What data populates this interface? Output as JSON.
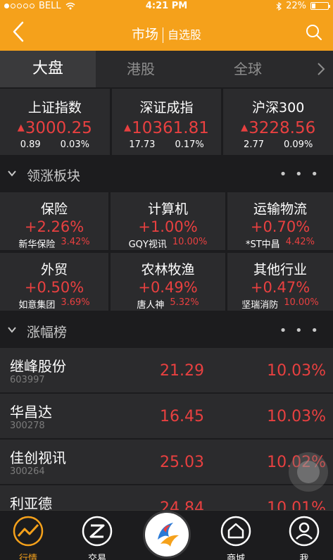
{
  "status_bar": {
    "carrier": "BELL",
    "time": "4:21 PM",
    "battery": "22%"
  },
  "nav": {
    "title": "市场",
    "subtitle": "自选股"
  },
  "tabs": [
    {
      "label": "大盘"
    },
    {
      "label": "港股"
    },
    {
      "label": "全球"
    }
  ],
  "indices": [
    {
      "name": "上证指数",
      "value": "3000.25",
      "change": "0.89",
      "pct": "0.03%"
    },
    {
      "name": "深证成指",
      "value": "10361.81",
      "change": "17.73",
      "pct": "0.17%"
    },
    {
      "name": "沪深300",
      "value": "3228.56",
      "change": "2.77",
      "pct": "0.09%"
    }
  ],
  "sectors_header": {
    "title": "领涨板块",
    "more": "• • •"
  },
  "sectors": [
    {
      "name": "保险",
      "change": "+2.26%",
      "leader": "新华保险",
      "leader_pct": "3.42%"
    },
    {
      "name": "计算机",
      "change": "+1.00%",
      "leader": "GQY视讯",
      "leader_pct": "10.00%"
    },
    {
      "name": "运输物流",
      "change": "+0.70%",
      "leader": "*ST中昌",
      "leader_pct": "4.42%"
    },
    {
      "name": "外贸",
      "change": "+0.50%",
      "leader": "如意集团",
      "leader_pct": "3.69%"
    },
    {
      "name": "农林牧渔",
      "change": "+0.49%",
      "leader": "唐人神",
      "leader_pct": "5.32%"
    },
    {
      "name": "其他行业",
      "change": "+0.47%",
      "leader": "坚瑞消防",
      "leader_pct": "10.00%"
    }
  ],
  "gainers_header": {
    "title": "涨幅榜",
    "more": "• • •"
  },
  "gainers": [
    {
      "name": "继峰股份",
      "code": "603997",
      "price": "21.29",
      "pct": "10.03%"
    },
    {
      "name": "华昌达",
      "code": "300278",
      "price": "16.45",
      "pct": "10.03%"
    },
    {
      "name": "佳创视讯",
      "code": "300264",
      "price": "25.03",
      "pct": "10.02%"
    },
    {
      "name": "利亚德",
      "code": "",
      "price": "24.84",
      "pct": "10.01%"
    }
  ],
  "bottom_nav": [
    {
      "label": "行情",
      "icon": "chart-line-icon"
    },
    {
      "label": "交易",
      "icon": "trade-icon"
    },
    {
      "label": "",
      "icon": "app-logo-icon"
    },
    {
      "label": "商城",
      "icon": "shop-icon"
    },
    {
      "label": "我",
      "icon": "user-icon"
    }
  ],
  "colors": {
    "accent": "#f5a11b",
    "up": "#e84040",
    "bg": "#1c1c1e",
    "card": "#2b2b2d"
  }
}
